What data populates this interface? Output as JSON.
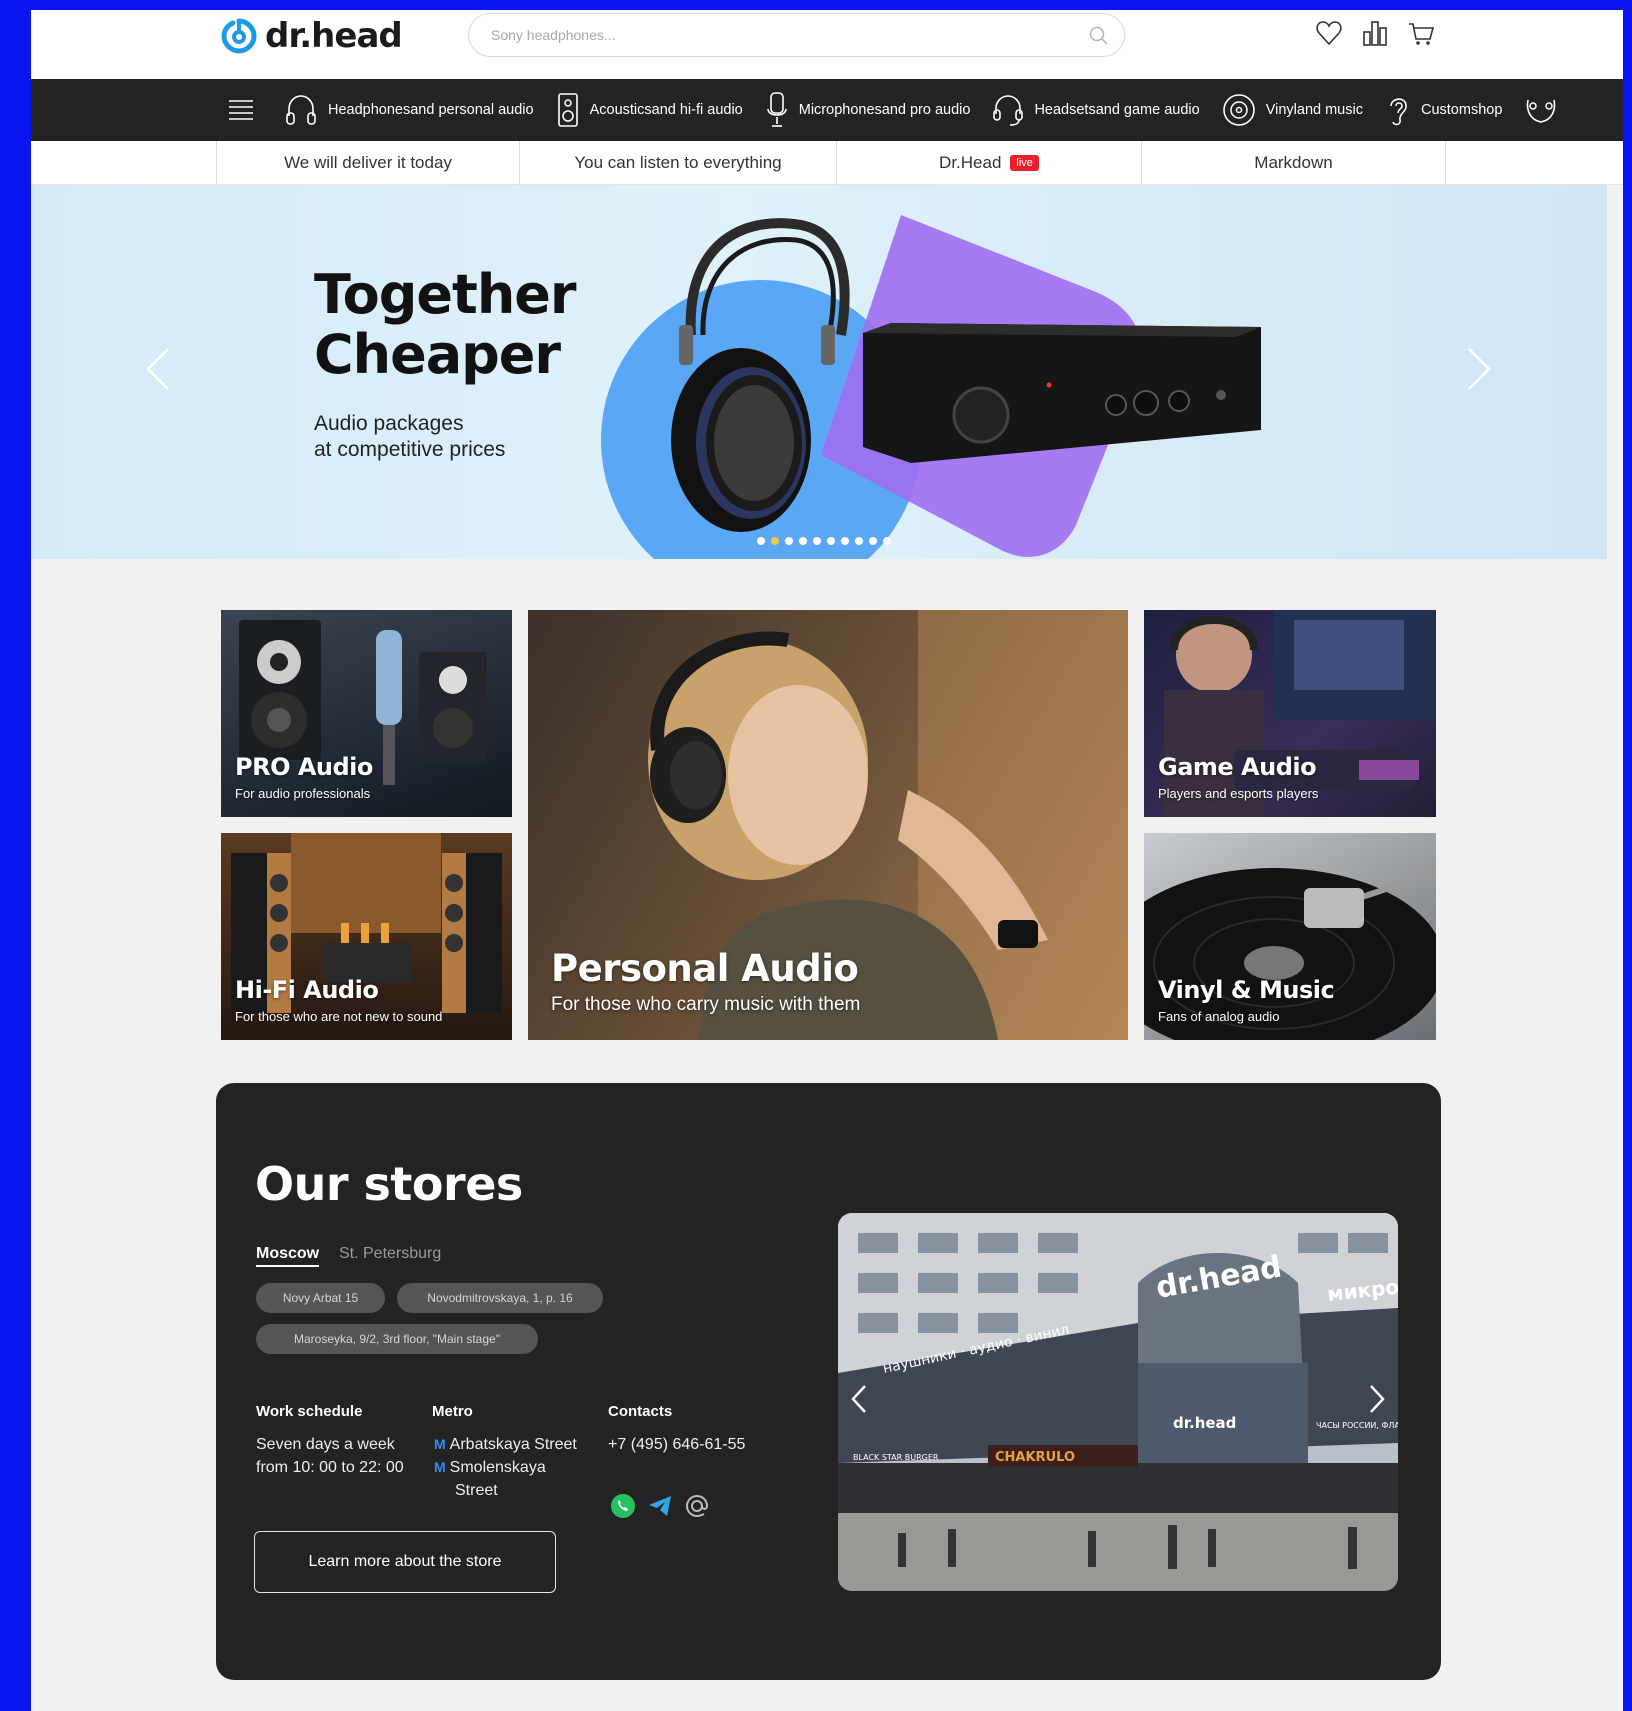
{
  "brand": {
    "name": "dr.head",
    "accent": "#1d9be8"
  },
  "search": {
    "placeholder": "Sony headphones..."
  },
  "header_icons": [
    "heart-icon",
    "compare-icon",
    "cart-icon"
  ],
  "nav": {
    "items": [
      {
        "label": "Headphonesand personal audio",
        "icon": "headphones-icon"
      },
      {
        "label": "Acousticsand hi-fi audio",
        "icon": "speaker-icon"
      },
      {
        "label": "Microphonesand pro audio",
        "icon": "microphone-icon"
      },
      {
        "label": "Headsetsand game audio",
        "icon": "headset-icon"
      },
      {
        "label": "Vinyland music",
        "icon": "vinyl-icon"
      },
      {
        "label": "Customshop",
        "icon": "ear-icon"
      }
    ]
  },
  "subnav": {
    "items": [
      "We will deliver it today",
      "You can listen to everything",
      "Dr.Head",
      "Markdown"
    ],
    "live_label": "live",
    "live_color": "#e8202a"
  },
  "hero": {
    "title_line1": "Together",
    "title_line2": "Cheaper",
    "subtitle_line1": "Audio packages",
    "subtitle_line2": "at competitive prices",
    "slide_count": 10,
    "active_slide": 2
  },
  "tiles": {
    "pro": {
      "title": "PRO Audio",
      "subtitle": "For audio professionals"
    },
    "personal": {
      "title": "Personal Audio",
      "subtitle": "For those who carry music with them"
    },
    "game": {
      "title": "Game Audio",
      "subtitle": "Players and esports players"
    },
    "hifi": {
      "title": "Hi-Fi Audio",
      "subtitle": "For those who are not new to sound"
    },
    "vinyl": {
      "title": "Vinyl & Music",
      "subtitle": "Fans of analog audio"
    }
  },
  "stores": {
    "title": "Our stores",
    "cities": [
      "Moscow",
      "St. Petersburg"
    ],
    "active_city": "Moscow",
    "addresses": [
      "Novy Arbat 15",
      "Novodmitrovskaya, 1, p. 16",
      "Maroseyka, 9/2, 3rd floor, \"Main stage\""
    ],
    "schedule_heading": "Work schedule",
    "schedule_line1": "Seven days a week",
    "schedule_line2": "from 10: 00 to 22: 00",
    "metro_heading": "Metro",
    "metro_1": "Arbatskaya Street",
    "metro_2_line1": "Smolenskaya",
    "metro_2_line2": "Street",
    "contacts_heading": "Contacts",
    "phone": "+7 (495) 646-61-55",
    "social": [
      "whatsapp-icon",
      "telegram-icon",
      "email-icon"
    ],
    "button_label": "Learn more about the store",
    "photo": {
      "sign_main": "dr.head",
      "sign_cyr": "микро",
      "banner": "наушники · аудио · винил",
      "sign_small": "dr.head",
      "restaurant": "CHAKRULO",
      "burger": "BLACK STAR BURGER",
      "clock": "ЧАСЫ РОССИИ, ФЛАГМАН"
    }
  }
}
